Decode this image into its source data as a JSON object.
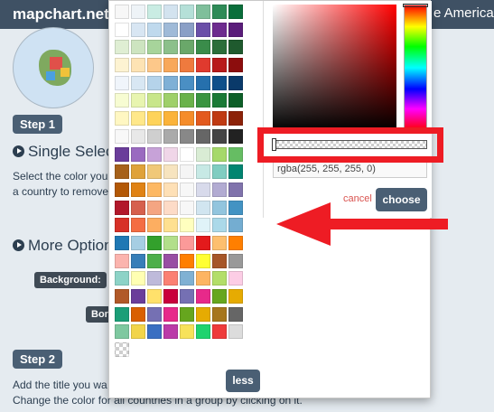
{
  "background": {
    "brand": "mapchart.net",
    "region_title": "e Americas",
    "step1_label": "Step 1",
    "single_select_heading": "Single Select",
    "instruction_line1": "Select the color you",
    "instruction_line2": "a country to remove",
    "more_options_heading": "More Option",
    "background_label": "Background:",
    "borders_label": "Bord",
    "step2_label": "Step 2",
    "step2_line1": "Add the title you wa",
    "step2_line2": "Change the color for all countries in a group by clicking on it."
  },
  "palette": {
    "swatches": [
      [
        "#f7f7f7",
        "#eef3f7",
        "#c9ece3",
        "#d3e3ef",
        "#b5e0d8",
        "#7fbf9b",
        "#2e8b57",
        "#0a6e3b"
      ],
      [
        "#ffffff",
        "#d8e6f3",
        "#bfd9ed",
        "#9fbad8",
        "#8a9fc6",
        "#6a4fa8",
        "#6d2b8f",
        "#5a1d7a"
      ],
      [
        "#dfeed3",
        "#cde4c0",
        "#a7d49b",
        "#8cc08b",
        "#6aa86a",
        "#3a8c4a",
        "#2b6e3a",
        "#1f5a2e"
      ],
      [
        "#fdf3d2",
        "#fde3b4",
        "#fdc88a",
        "#f8a85a",
        "#ef7a3e",
        "#e03a2e",
        "#b81a1a",
        "#8c0d0d"
      ],
      [
        "#f0f5fb",
        "#d8e7f3",
        "#b5d3ea",
        "#7fb0d6",
        "#4a8fc4",
        "#2670ad",
        "#0e4f8a",
        "#0a3a6a"
      ],
      [
        "#f7fcd2",
        "#e8f5b0",
        "#c8e68a",
        "#9fd06a",
        "#6ab24a",
        "#3a9440",
        "#1a7a35",
        "#0d5f28"
      ],
      [
        "#fff7c2",
        "#ffe88a",
        "#fed35a",
        "#fbb33a",
        "#f58c2a",
        "#e35a1e",
        "#c03a12",
        "#8c2208"
      ],
      [
        "#f8f8f8",
        "#e8e8e8",
        "#cfcfcf",
        "#aaaaaa",
        "#888888",
        "#666666",
        "#444444",
        "#222222"
      ],
      [
        "#6a3d9a",
        "#9a6ac0",
        "#c7a2d8",
        "#f0d6e8",
        "#ffffff",
        "#d9ecd4",
        "#a6d96a",
        "#66bd63"
      ],
      [
        "#a6611a",
        "#dfa23a",
        "#f0c878",
        "#f7e4bf",
        "#f5f5f5",
        "#c7e9e5",
        "#80cdc1",
        "#018571"
      ],
      [
        "#b35806",
        "#e08214",
        "#fdb863",
        "#fee0b6",
        "#f7f7f7",
        "#d8daeb",
        "#b2abd2",
        "#8073ac"
      ],
      [
        "#b2182b",
        "#d6604d",
        "#f4a582",
        "#fddbc7",
        "#f7f7f7",
        "#d1e5f0",
        "#92c5de",
        "#4393c3"
      ],
      [
        "#d73027",
        "#f46d43",
        "#fdae61",
        "#fee090",
        "#ffffbf",
        "#e0f3f8",
        "#abd9e9",
        "#74add1"
      ],
      [
        "#1f78b4",
        "#a6cee3",
        "#33a02c",
        "#b2df8a",
        "#fb9a99",
        "#e31a1c",
        "#fdbf6f",
        "#ff7f00"
      ],
      [
        "#fbb4ae",
        "#377eb8",
        "#4daf4a",
        "#984ea3",
        "#ff7f00",
        "#ffff33",
        "#a65628",
        "#999999"
      ],
      [
        "#8dd3c7",
        "#ffffb3",
        "#bebada",
        "#fb8072",
        "#80b1d3",
        "#fdb462",
        "#b3de69",
        "#fccde5"
      ],
      [
        "#b15928",
        "#6a3d9a",
        "#ffe16b",
        "#c9003c",
        "#7570b3",
        "#e7298a",
        "#66a61e",
        "#e6ab02"
      ],
      [
        "#1b9e77",
        "#d95f02",
        "#7570b3",
        "#e7298a",
        "#66a61e",
        "#e6ab02",
        "#a6761d",
        "#666666"
      ],
      [
        "#7ec8a0",
        "#f2d44a",
        "#3a6fc2",
        "#bb3aa8",
        "#f7e25a",
        "#1fd36e",
        "#ee3a3a",
        "#dcdcdc"
      ],
      [
        "transparent"
      ]
    ],
    "less_label": "less"
  },
  "picker": {
    "rgba_value": "rgba(255, 255, 255, 0)",
    "alpha": 0,
    "cancel_label": "cancel",
    "choose_label": "choose",
    "sv_color": "#ff0000"
  },
  "annotation": {
    "highlight_color": "#ee1c24",
    "arrow_color": "#ee1c24"
  }
}
